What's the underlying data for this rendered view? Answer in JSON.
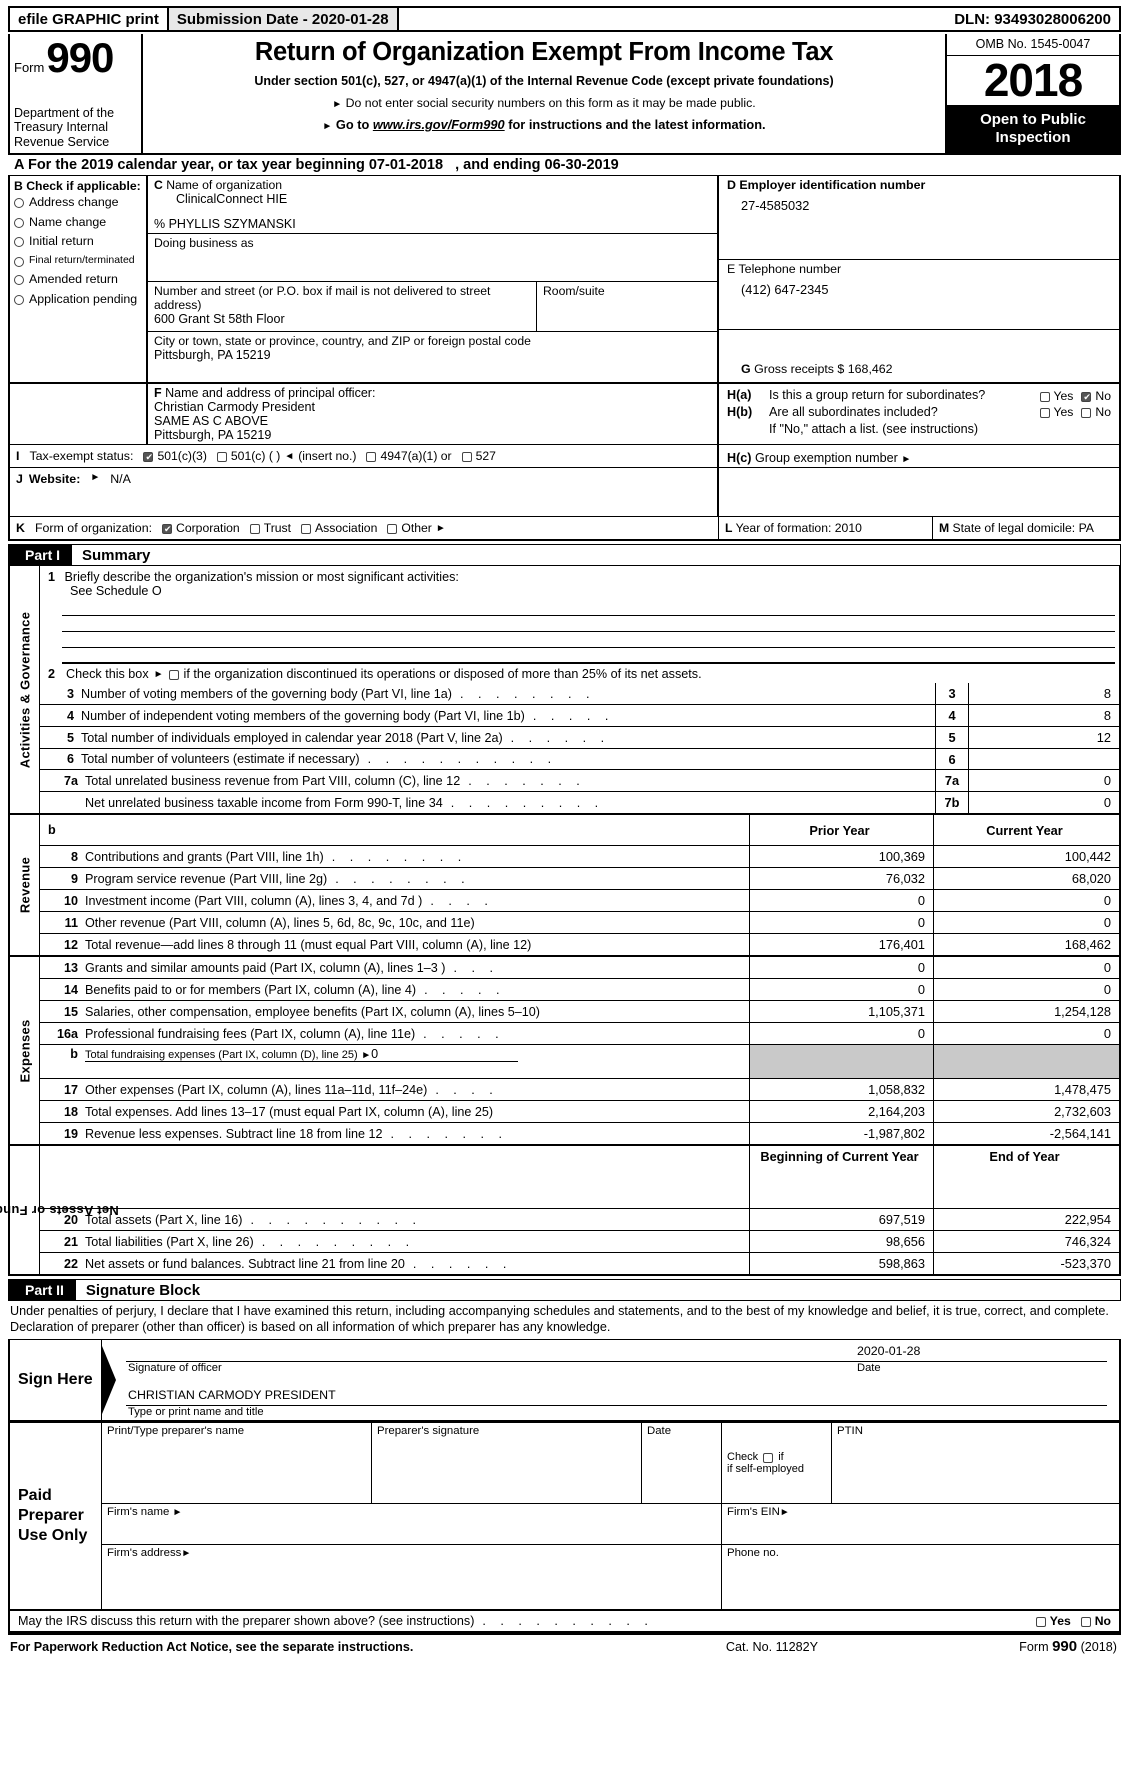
{
  "efile": {
    "graphic_print": "efile GRAPHIC print",
    "submission_date": "Submission Date - 2020-01-28",
    "dln": "DLN: 93493028006200"
  },
  "masthead": {
    "form_label": "Form",
    "form_number": "990",
    "department": "Department of the Treasury Internal Revenue Service",
    "title": "Return of Organization Exempt From Income Tax",
    "subtitle1": "Under section 501(c), 527, or 4947(a)(1) of the Internal Revenue Code (except private foundations)",
    "subtitle2": "Do not enter social security numbers on this form as it may be made public.",
    "subtitle3_pre": "Go to",
    "subtitle3_link": "www.irs.gov/Form990",
    "subtitle3_post": "for instructions and the latest information.",
    "omb": "OMB No. 1545-0047",
    "year": "2018",
    "open_to_public": "Open to Public Inspection"
  },
  "lineA": {
    "label": "A",
    "text_pre": "For the 2019 calendar year, or tax year beginning",
    "begin_date": "07-01-2018",
    "text_mid": ", and ending",
    "end_date": "06-30-2019"
  },
  "sectionB": {
    "label": "B",
    "title": "Check if applicable:",
    "options": [
      {
        "label": "Address change",
        "checked": false
      },
      {
        "label": "Name change",
        "checked": false
      },
      {
        "label": "Initial return",
        "checked": false
      },
      {
        "label": "Final return/terminated",
        "checked": false
      },
      {
        "label": "Amended return",
        "checked": false
      },
      {
        "label": "Application pending",
        "checked": false
      }
    ]
  },
  "sectionC": {
    "label": "C",
    "name_label": "Name of organization",
    "org_name": "ClinicalConnect HIE",
    "care_of": "% PHYLLIS SZYMANSKI",
    "dba_label": "Doing business as",
    "dba_value": "",
    "street_label": "Number and street (or P.O. box if mail is not delivered to street address)",
    "street_value": "600 Grant St 58th Floor",
    "room_label": "Room/suite",
    "room_value": "",
    "city_label": "City or town, state or province, country, and ZIP or foreign postal code",
    "city_value": "Pittsburgh, PA   15219"
  },
  "sectionD": {
    "label": "D",
    "title": "Employer identification number",
    "value": "27-4585032"
  },
  "sectionE": {
    "label": "E",
    "title": "Telephone number",
    "value": "(412) 647-2345"
  },
  "sectionG": {
    "label": "G",
    "title": "Gross receipts $",
    "value": "168,462"
  },
  "sectionF": {
    "label": "F",
    "title": "Name and address of principal officer:",
    "line1": "Christian Carmody President",
    "line2": "SAME AS C ABOVE",
    "line3": "Pittsburgh, PA  15219"
  },
  "sectionH": {
    "a_label": "H(a)",
    "a_text": "Is this a group return for subordinates?",
    "a_yes": "Yes",
    "a_no": "No",
    "a_yes_checked": false,
    "a_no_checked": true,
    "b_label": "H(b)",
    "b_text": "Are all subordinates included?",
    "b_yes": "Yes",
    "b_no": "No",
    "b_yes_checked": false,
    "b_no_checked": false,
    "b_note": "If \"No,\" attach a list. (see instructions)",
    "c_label": "H(c)",
    "c_text": "Group exemption number"
  },
  "sectionI": {
    "label": "I",
    "title": "Tax-exempt status:",
    "options": [
      {
        "label": "501(c)(3)",
        "checked": true
      },
      {
        "label": "501(c) (   )",
        "checked": false,
        "suffix": "(insert no.)"
      },
      {
        "label": "4947(a)(1) or",
        "checked": false
      },
      {
        "label": "527",
        "checked": false
      }
    ]
  },
  "sectionJ": {
    "label": "J",
    "title": "Website:",
    "value": "N/A"
  },
  "sectionK": {
    "label": "K",
    "title": "Form of organization:",
    "options": [
      {
        "label": "Corporation",
        "checked": true
      },
      {
        "label": "Trust",
        "checked": false
      },
      {
        "label": "Association",
        "checked": false
      },
      {
        "label": "Other",
        "checked": false
      }
    ]
  },
  "sectionL": {
    "label": "L",
    "title": "Year of formation:",
    "value": "2010"
  },
  "sectionM": {
    "label": "M",
    "title": "State of legal domicile:",
    "value": "PA"
  },
  "partI": {
    "tag": "Part I",
    "title": "Summary",
    "sidebars": {
      "activities": "Activities & Governance",
      "revenue": "Revenue",
      "expenses": "Expenses",
      "netassets": "Net Assets or Fund Balances"
    },
    "line1": {
      "num": "1",
      "text": "Briefly describe the organization's mission or most significant activities:",
      "value": "See Schedule O"
    },
    "line2": {
      "num": "2",
      "text_pre": "Check this box",
      "text_post": "if the organization discontinued its operations or disposed of more than 25% of its net assets.",
      "checked": false
    },
    "governance_rows": [
      {
        "num": "3",
        "text": "Number of voting members of the governing body (Part VI, line 1a)",
        "key": "3",
        "value": "8"
      },
      {
        "num": "4",
        "text": "Number of independent voting members of the governing body (Part VI, line 1b)",
        "key": "4",
        "value": "8"
      },
      {
        "num": "5",
        "text": "Total number of individuals employed in calendar year 2018 (Part V, line 2a)",
        "key": "5",
        "value": "12"
      },
      {
        "num": "6",
        "text": "Total number of volunteers (estimate if necessary)",
        "key": "6",
        "value": ""
      },
      {
        "num": "7a",
        "text": "Total unrelated business revenue from Part VIII, column (C), line 12",
        "key": "7a",
        "value": "0"
      },
      {
        "num": "",
        "text": "Net unrelated business taxable income from Form 990-T, line 34",
        "key": "7b",
        "value": "0"
      }
    ],
    "b_marker": "b",
    "col_headers_1": {
      "prior": "Prior Year",
      "current": "Current Year"
    },
    "revenue_rows": [
      {
        "num": "8",
        "text": "Contributions and grants (Part VIII, line 1h)",
        "prior": "100,369",
        "current": "100,442"
      },
      {
        "num": "9",
        "text": "Program service revenue (Part VIII, line 2g)",
        "prior": "76,032",
        "current": "68,020"
      },
      {
        "num": "10",
        "text": "Investment income (Part VIII, column (A), lines 3, 4, and 7d )",
        "prior": "0",
        "current": "0"
      },
      {
        "num": "11",
        "text": "Other revenue (Part VIII, column (A), lines 5, 6d, 8c, 9c, 10c, and 11e)",
        "prior": "0",
        "current": "0"
      },
      {
        "num": "12",
        "text": "Total revenue—add lines 8 through 11 (must equal Part VIII, column (A), line 12)",
        "prior": "176,401",
        "current": "168,462"
      }
    ],
    "expense_rows": [
      {
        "num": "13",
        "text": "Grants and similar amounts paid (Part IX, column (A), lines 1–3 )",
        "prior": "0",
        "current": "0"
      },
      {
        "num": "14",
        "text": "Benefits paid to or for members (Part IX, column (A), line 4)",
        "prior": "0",
        "current": "0"
      },
      {
        "num": "15",
        "text": "Salaries, other compensation, employee benefits (Part IX, column (A), lines 5–10)",
        "prior": "1,105,371",
        "current": "1,254,128"
      },
      {
        "num": "16a",
        "text": "Professional fundraising fees (Part IX, column (A), line 11e)",
        "prior": "0",
        "current": "0"
      }
    ],
    "line16b": {
      "num": "b",
      "text": "Total fundraising expenses (Part IX, column (D), line 25)",
      "value": "0"
    },
    "expense_rows2": [
      {
        "num": "17",
        "text": "Other expenses (Part IX, column (A), lines 11a–11d, 11f–24e)",
        "prior": "1,058,832",
        "current": "1,478,475"
      },
      {
        "num": "18",
        "text": "Total expenses. Add lines 13–17 (must equal Part IX, column (A), line 25)",
        "prior": "2,164,203",
        "current": "2,732,603"
      },
      {
        "num": "19",
        "text": "Revenue less expenses. Subtract line 18 from line 12",
        "prior": "-1,987,802",
        "current": "-2,564,141"
      }
    ],
    "col_headers_2": {
      "begin": "Beginning of Current Year",
      "end": "End of Year"
    },
    "netasset_rows": [
      {
        "num": "20",
        "text": "Total assets (Part X, line 16)",
        "prior": "697,519",
        "current": "222,954"
      },
      {
        "num": "21",
        "text": "Total liabilities (Part X, line 26)",
        "prior": "98,656",
        "current": "746,324"
      },
      {
        "num": "22",
        "text": "Net assets or fund balances. Subtract line 21 from line 20",
        "prior": "598,863",
        "current": "-523,370"
      }
    ]
  },
  "partII": {
    "tag": "Part II",
    "title": "Signature Block",
    "perjury": "Under penalties of perjury, I declare that I have examined this return, including accompanying schedules and statements, and to the best of my knowledge and belief, it is true, correct, and complete. Declaration of preparer (other than officer) is based on all information of which preparer has any knowledge.",
    "sign_here": "Sign Here",
    "signature_of_officer": "Signature of officer",
    "date_label": "Date",
    "date_value": "2020-01-28",
    "officer_name": "CHRISTIAN CARMODY  PRESIDENT",
    "type_or_print": "Type or print name and title",
    "paid_preparer": "Paid Preparer Use Only",
    "prep_name_label": "Print/Type preparer's name",
    "prep_sig_label": "Preparer's signature",
    "prep_date_label": "Date",
    "prep_check_label": "Check",
    "prep_check_suffix": "if self-employed",
    "prep_ptin_label": "PTIN",
    "firm_name_label": "Firm's name",
    "firm_ein_label": "Firm's EIN",
    "firm_address_label": "Firm's address",
    "phone_label": "Phone no.",
    "irs_discuss": "May the IRS discuss this return with the preparer shown above? (see instructions)",
    "irs_yes": "Yes",
    "irs_no": "No"
  },
  "footer": {
    "paperwork": "For Paperwork Reduction Act Notice, see the separate instructions.",
    "cat_no": "Cat. No. 11282Y",
    "form_pre": "Form",
    "form_num": "990",
    "form_year": "(2018)"
  }
}
